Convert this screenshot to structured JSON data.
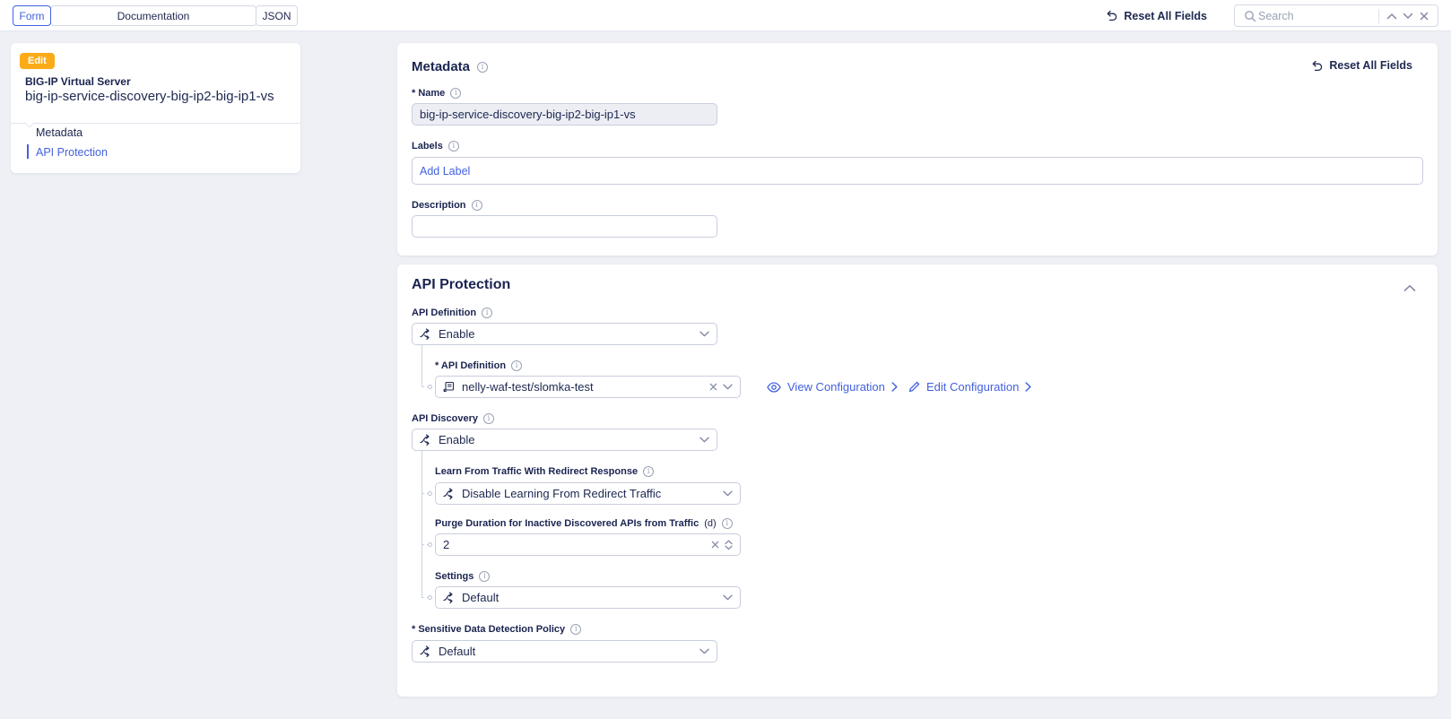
{
  "colors": {
    "accent_blue": "#4261e0",
    "navy_text": "#202a52",
    "badge_orange": "#fbab17",
    "page_background": "#eef0f5",
    "border_gray": "#c8cedd",
    "muted_gray": "#9aa1b5"
  },
  "icons": {
    "reset": "undo-arrow",
    "search": "magnifier",
    "info": "circled-i",
    "dropdown": "chevron-down",
    "collapse": "chevron-up",
    "clear": "x-mark",
    "choice": "branch-split-arrows",
    "reference": "object-reference-box",
    "view": "eye",
    "edit": "pencil",
    "go": "chevron-right",
    "spinner": "chevron-up-down"
  },
  "topbar": {
    "tabs": [
      {
        "label": "Form",
        "active": true
      },
      {
        "label": "Documentation",
        "active": false
      },
      {
        "label": "JSON",
        "active": false
      }
    ],
    "reset_all_fields": "Reset All Fields",
    "search": {
      "placeholder": "Search"
    }
  },
  "sidebar": {
    "badge": "Edit",
    "type_title": "BIG-IP Virtual Server",
    "object_name": "big-ip-service-discovery-big-ip2-big-ip1-vs",
    "nav": [
      {
        "label": "Metadata",
        "active": false
      },
      {
        "label": "API Protection",
        "active": true
      }
    ]
  },
  "metadata_card": {
    "title": "Metadata",
    "reset_all_fields": "Reset All Fields",
    "name": {
      "label": "* Name",
      "value": "big-ip-service-discovery-big-ip2-big-ip1-vs"
    },
    "labels": {
      "label": "Labels",
      "add_label": "Add Label"
    },
    "description": {
      "label": "Description",
      "value": ""
    }
  },
  "api_card": {
    "title": "API Protection",
    "api_definition_toggle": {
      "label": "API Definition",
      "value": "Enable"
    },
    "api_definition_ref": {
      "label": "* API Definition",
      "value": "nelly-waf-test/slomka-test"
    },
    "view_configuration": "View Configuration",
    "edit_configuration": "Edit Configuration",
    "api_discovery": {
      "label": "API Discovery",
      "value": "Enable"
    },
    "learn_redirect": {
      "label": "Learn From Traffic With Redirect Response",
      "value": "Disable Learning From Redirect Traffic"
    },
    "purge_duration": {
      "label": "Purge Duration for Inactive Discovered APIs from Traffic",
      "unit": "(d)",
      "value": "2"
    },
    "settings": {
      "label": "Settings",
      "value": "Default"
    },
    "sensitive_data": {
      "label": "* Sensitive Data Detection Policy",
      "value": "Default"
    }
  }
}
